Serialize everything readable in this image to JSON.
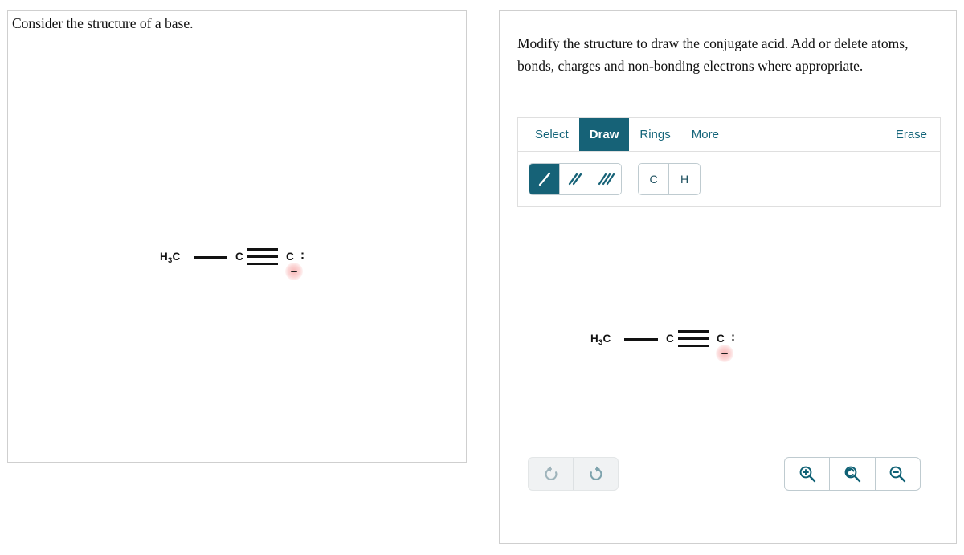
{
  "left_panel": {
    "prompt": "Consider the structure of a base.",
    "molecule": {
      "name": "propynide-anion",
      "methyl_label": "H3C",
      "methyl_label_main": "H",
      "methyl_sub": "3",
      "methyl_tail": "C",
      "carbon_label": "C",
      "terminal_carbon_label": "C",
      "lone_pair": ":",
      "charge": "−",
      "charge_name": "negative-charge",
      "bonds": [
        "single",
        "triple"
      ]
    }
  },
  "right_panel": {
    "prompt": "Modify the structure to draw the conjugate acid. Add or delete atoms, bonds, charges and non-bonding electrons where appropriate.",
    "toolbar": {
      "tabs": [
        {
          "label": "Select",
          "active": false
        },
        {
          "label": "Draw",
          "active": true
        },
        {
          "label": "Rings",
          "active": false
        },
        {
          "label": "More",
          "active": false
        }
      ],
      "erase_label": "Erase",
      "bond_tools": [
        {
          "name": "single-bond-tool",
          "label": "single bond",
          "active": true
        },
        {
          "name": "double-bond-tool",
          "label": "double bond",
          "active": false
        },
        {
          "name": "triple-bond-tool",
          "label": "triple bond",
          "active": false
        }
      ],
      "atom_tools": [
        {
          "name": "carbon-atom-tool",
          "label": "C"
        },
        {
          "name": "hydrogen-atom-tool",
          "label": "H"
        }
      ]
    },
    "canvas_molecule": {
      "name": "propynide-anion",
      "methyl_label_main": "H",
      "methyl_sub": "3",
      "methyl_tail": "C",
      "carbon_label": "C",
      "terminal_carbon_label": "C",
      "lone_pair": ":",
      "charge": "−"
    },
    "controls": {
      "undo": "undo",
      "redo": "redo",
      "zoom_in": "zoom-in",
      "zoom_reset": "zoom-reset",
      "zoom_out": "zoom-out"
    }
  },
  "colors": {
    "accent_teal": "#166277",
    "tab_text_teal": "#15657a",
    "charge_pink": "#f8b4b4",
    "panel_border": "#cfcfcf",
    "toolbar_border": "#dfdfdf"
  }
}
